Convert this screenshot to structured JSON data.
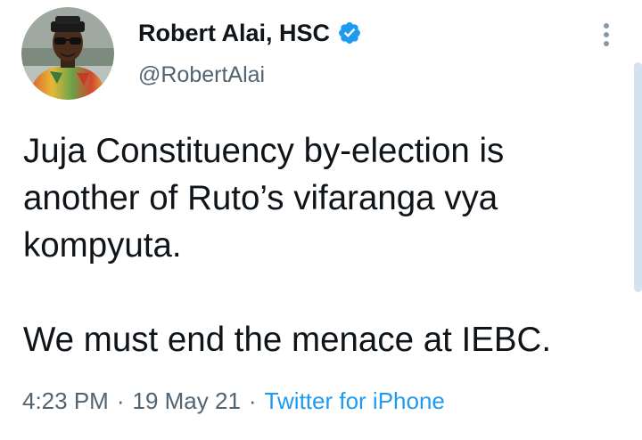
{
  "author": {
    "display_name": "Robert Alai, HSC",
    "handle": "@RobertAlai",
    "verified": true,
    "avatar_icon": "user-avatar-photo"
  },
  "tweet": {
    "paragraphs": [
      "Juja Constituency by-election is another of Ruto’s vifaranga vya kompyuta.",
      "We must end the menace at IEBC."
    ],
    "lines": [
      "Juja Constituency by-election is",
      "another of Ruto’s vifaranga vya",
      "kompyuta.",
      "We must end the menace at IEBC."
    ]
  },
  "meta": {
    "time": "4:23 PM",
    "separator": "·",
    "date": "19 May 21",
    "source": "Twitter for iPhone"
  },
  "colors": {
    "text": "#0f1419",
    "secondary": "#536471",
    "accent": "#1d9bf0",
    "scrollbar": "#d4e2ef"
  },
  "icons": {
    "verified": "verified-badge-icon",
    "more": "more-vertical-icon"
  }
}
